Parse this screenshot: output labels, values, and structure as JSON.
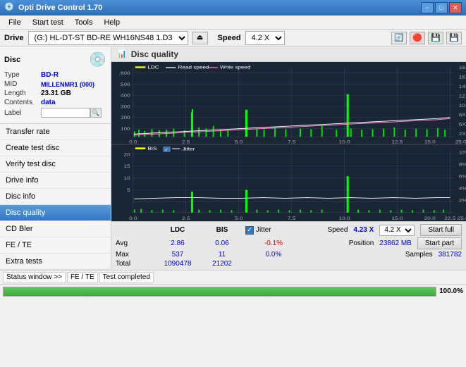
{
  "titleBar": {
    "icon": "💿",
    "title": "Opti Drive Control 1.70",
    "minimizeLabel": "−",
    "maximizeLabel": "□",
    "closeLabel": "✕"
  },
  "menuBar": {
    "items": [
      "File",
      "Start test",
      "Tools",
      "Help"
    ]
  },
  "driveBar": {
    "driveLabel": "Drive",
    "driveValue": "(G:)  HL-DT-ST BD-RE  WH16NS48 1.D3",
    "speedLabel": "Speed",
    "speedValue": "4.2 X"
  },
  "discPanel": {
    "type": {
      "label": "Type",
      "value": "BD-R"
    },
    "mid": {
      "label": "MID",
      "value": "MILLENMR1 (000)"
    },
    "length": {
      "label": "Length",
      "value": "23.31 GB"
    },
    "contents": {
      "label": "Contents",
      "value": "data"
    },
    "label": {
      "label": "Label",
      "value": ""
    }
  },
  "navItems": [
    {
      "id": "transfer-rate",
      "label": "Transfer rate",
      "active": false
    },
    {
      "id": "create-test-disc",
      "label": "Create test disc",
      "active": false
    },
    {
      "id": "verify-test-disc",
      "label": "Verify test disc",
      "active": false
    },
    {
      "id": "drive-info",
      "label": "Drive info",
      "active": false
    },
    {
      "id": "disc-info",
      "label": "Disc info",
      "active": false
    },
    {
      "id": "disc-quality",
      "label": "Disc quality",
      "active": true
    },
    {
      "id": "cd-bler",
      "label": "CD Bler",
      "active": false
    },
    {
      "id": "fe-te",
      "label": "FE / TE",
      "active": false
    },
    {
      "id": "extra-tests",
      "label": "Extra tests",
      "active": false
    }
  ],
  "panelTitle": "Disc quality",
  "chartLegend": {
    "ldc": {
      "label": "LDC",
      "color": "#ffff00"
    },
    "readSpeed": {
      "label": "Read speed",
      "color": "#ffffff"
    },
    "writeSpeed": {
      "label": "Write speed",
      "color": "#ff88cc"
    }
  },
  "chartLegend2": {
    "bis": {
      "label": "BIS",
      "color": "#ffff00"
    },
    "jitter": {
      "label": "Jitter",
      "color": "#ffffff"
    }
  },
  "statsSection": {
    "columns": [
      "LDC",
      "BIS",
      "",
      "Jitter"
    ],
    "avg": {
      "label": "Avg",
      "ldc": "2.86",
      "bis": "0.06",
      "jitter": "-0.1%"
    },
    "max": {
      "label": "Max",
      "ldc": "537",
      "bis": "11",
      "jitter": "0.0%"
    },
    "total": {
      "label": "Total",
      "ldc": "1090478",
      "bis": "21202",
      "jitter": ""
    },
    "speed": {
      "label": "Speed",
      "value": "4.23 X"
    },
    "speedSelect": "4.2 X",
    "position": {
      "label": "Position",
      "value": "23862 MB"
    },
    "samples": {
      "label": "Samples",
      "value": "381782"
    },
    "startFull": "Start full",
    "startPart": "Start part"
  },
  "statusBar": {
    "statusWindow": "Status window >>",
    "feTeLabel": "FE / TE",
    "testCompleted": "Test completed"
  },
  "progressBar": {
    "percent": 100,
    "label": "100.0%"
  }
}
